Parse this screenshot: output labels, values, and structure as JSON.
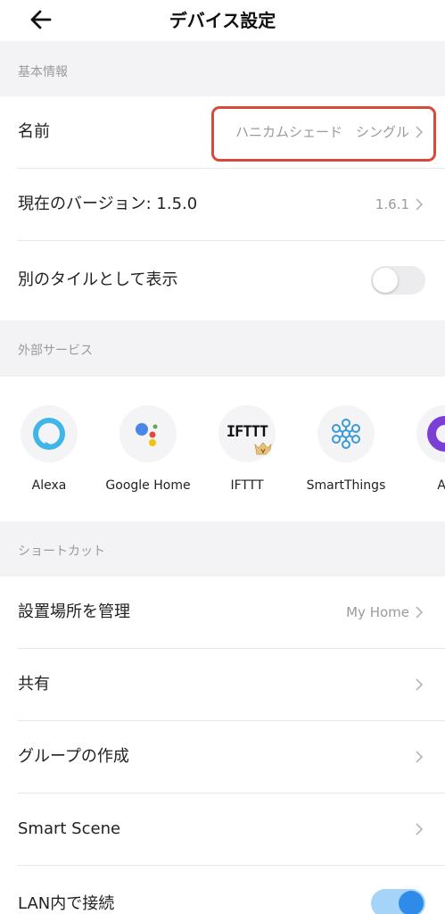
{
  "header": {
    "title": "デバイス設定"
  },
  "sections": {
    "basic": "基本情報",
    "external": "外部サービス",
    "shortcut": "ショートカット"
  },
  "basic": {
    "name_label": "名前",
    "name_value": "ハニカムシェード　シングル",
    "version_label": "現在のバージョン:  1.5.0",
    "version_value": "1.6.1",
    "tile_label": "別のタイルとして表示",
    "tile_toggle": "off"
  },
  "services": [
    {
      "label": "Alexa",
      "icon": "alexa-icon"
    },
    {
      "label": "Google Home",
      "icon": "google-assistant-icon"
    },
    {
      "label": "IFTTT",
      "icon": "ifttt-icon",
      "logo_text": "IFTTT"
    },
    {
      "label": "SmartThings",
      "icon": "smartthings-icon"
    },
    {
      "label": "Ali",
      "icon": "alice-icon"
    }
  ],
  "shortcuts": {
    "location_label": "設置場所を管理",
    "location_value": "My Home",
    "share_label": "共有",
    "group_label": "グループの作成",
    "scene_label": "Smart Scene",
    "lan_label": "LAN内で接続",
    "lan_toggle": "on"
  },
  "colors": {
    "highlight": "#d9483b",
    "toggle_on": "#2e8ce8",
    "alexa": "#3fb5e8"
  }
}
